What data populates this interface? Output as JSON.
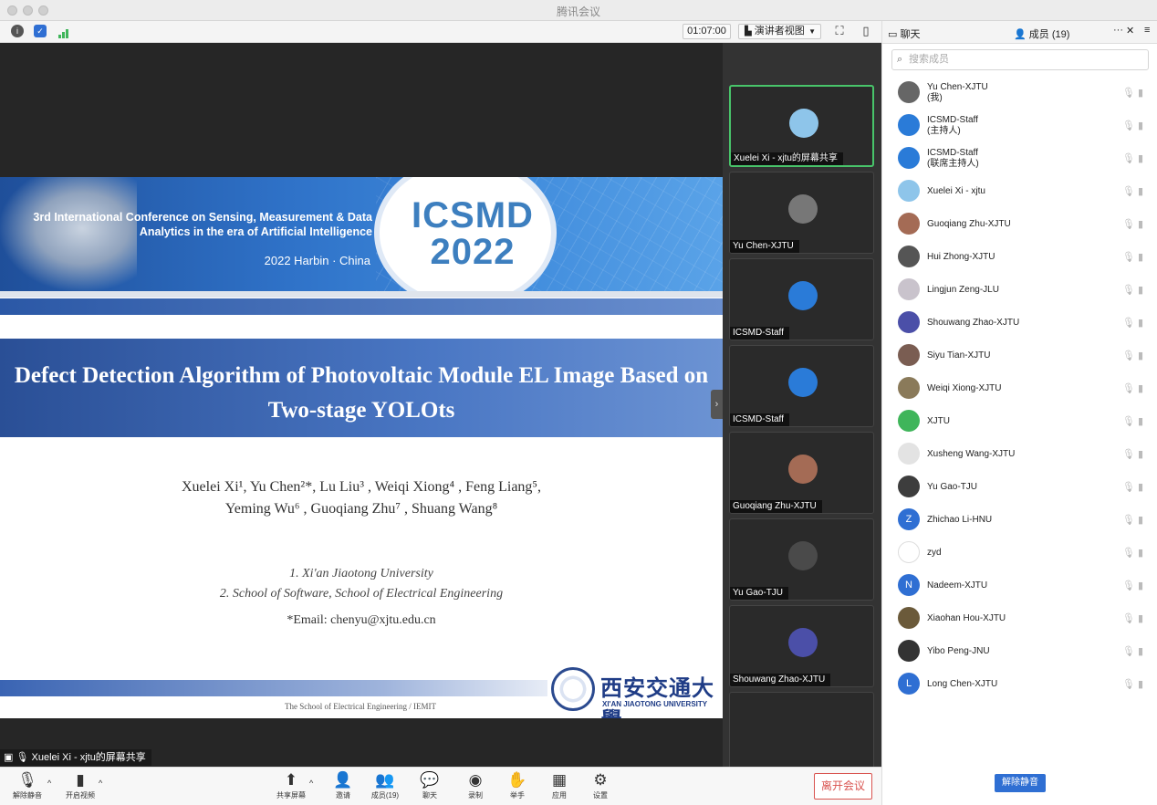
{
  "window": {
    "title": "腾讯会议"
  },
  "toolbar": {
    "timer": "01:07:00",
    "view_label": "演讲者视图"
  },
  "slide": {
    "conference": "3rd International Conference on Sensing, Measurement & Data Analytics in the era of Artificial Intelligence",
    "place": "2022 Harbin · China",
    "logo_line1": "ICSMD",
    "logo_line2": "2022",
    "title": "Defect Detection Algorithm of Photovoltaic Module EL Image Based on Two-stage YOLOts",
    "authors_line1": "Xuelei Xi¹, Yu Chen²*, Lu Liu³ , Weiqi Xiong⁴ , Feng Liang⁵,",
    "authors_line2": "Yeming Wu⁶ , Guoqiang Zhu⁷ , Shuang Wang⁸",
    "affil_1": "1. Xi'an Jiaotong University",
    "affil_2": "2. School of Software, School of Electrical Engineering",
    "email": "*Email: chenyu@xjtu.edu.cn",
    "footer_school": "The School of Electrical Engineering / IEMIT",
    "univ_cn": "西安交通大學",
    "univ_en": "XI'AN JIAOTONG UNIVERSITY"
  },
  "share_label": "Xuelei Xi - xjtu的屏幕共享",
  "gallery": [
    {
      "name": "Xuelei Xi - xjtu的屏幕共享",
      "color": "#8ec5ea"
    },
    {
      "name": "Yu Chen-XJTU",
      "color": "#777777"
    },
    {
      "name": "ICSMD-Staff",
      "color": "#2a7bd8"
    },
    {
      "name": "ICSMD-Staff",
      "color": "#2a7bd8"
    },
    {
      "name": "Guoqiang Zhu-XJTU",
      "color": "#a46b55"
    },
    {
      "name": "Yu Gao-TJU",
      "color": "#4a4a4a"
    },
    {
      "name": "Shouwang Zhao-XJTU",
      "color": "#4b4fa8"
    }
  ],
  "bottombar": {
    "mute": "解除静音",
    "video": "开启视频",
    "share": "共享屏幕",
    "invite": "邀请",
    "members": "成员(19)",
    "chat": "聊天",
    "record": "录制",
    "raise_hand": "举手",
    "apps": "应用",
    "settings": "设置",
    "leave": "离开会议"
  },
  "panel": {
    "tab_chat": "聊天",
    "tab_members": "成员 (19)",
    "search_placeholder": "搜索成员",
    "unmute_all": "解除静音",
    "members": [
      {
        "name": "Yu Chen-XJTU",
        "role": "(我)",
        "color": "#666666",
        "letter": ""
      },
      {
        "name": "ICSMD-Staff",
        "role": "(主持人)",
        "color": "#2a7bd8",
        "letter": ""
      },
      {
        "name": "ICSMD-Staff",
        "role": "(联席主持人)",
        "color": "#2a7bd8",
        "letter": ""
      },
      {
        "name": "Xuelei Xi - xjtu",
        "role": "",
        "color": "#8ec5ea",
        "letter": ""
      },
      {
        "name": "Guoqiang Zhu-XJTU",
        "role": "",
        "color": "#a46b55",
        "letter": ""
      },
      {
        "name": "Hui Zhong-XJTU",
        "role": "",
        "color": "#555555",
        "letter": ""
      },
      {
        "name": "Lingjun Zeng-JLU",
        "role": "",
        "color": "#c9c3cc",
        "letter": ""
      },
      {
        "name": "Shouwang Zhao-XJTU",
        "role": "",
        "color": "#4b4fa8",
        "letter": ""
      },
      {
        "name": "Siyu Tian-XJTU",
        "role": "",
        "color": "#7a5d52",
        "letter": ""
      },
      {
        "name": "Weiqi Xiong-XJTU",
        "role": "",
        "color": "#8a7a5a",
        "letter": ""
      },
      {
        "name": "XJTU",
        "role": "",
        "color": "#3fb55a",
        "letter": ""
      },
      {
        "name": "Xusheng Wang-XJTU",
        "role": "",
        "color": "#e3e3e3",
        "letter": ""
      },
      {
        "name": "Yu Gao-TJU",
        "role": "",
        "color": "#3d3d3d",
        "letter": ""
      },
      {
        "name": "Zhichao Li-HNU",
        "role": "",
        "color": "#2f6fd3",
        "letter": "Z"
      },
      {
        "name": "zyd",
        "role": "",
        "color": "#ffffff",
        "letter": ""
      },
      {
        "name": "Nadeem-XJTU",
        "role": "",
        "color": "#2f6fd3",
        "letter": "N"
      },
      {
        "name": "Xiaohan Hou-XJTU",
        "role": "",
        "color": "#6b5a3a",
        "letter": ""
      },
      {
        "name": "Yibo Peng-JNU",
        "role": "",
        "color": "#333333",
        "letter": ""
      },
      {
        "name": "Long Chen-XJTU",
        "role": "",
        "color": "#2f6fd3",
        "letter": "L"
      }
    ]
  },
  "colors": {
    "accent": "#2f6fd3",
    "leave": "#d9534f",
    "active_tile": "#48c46a"
  }
}
